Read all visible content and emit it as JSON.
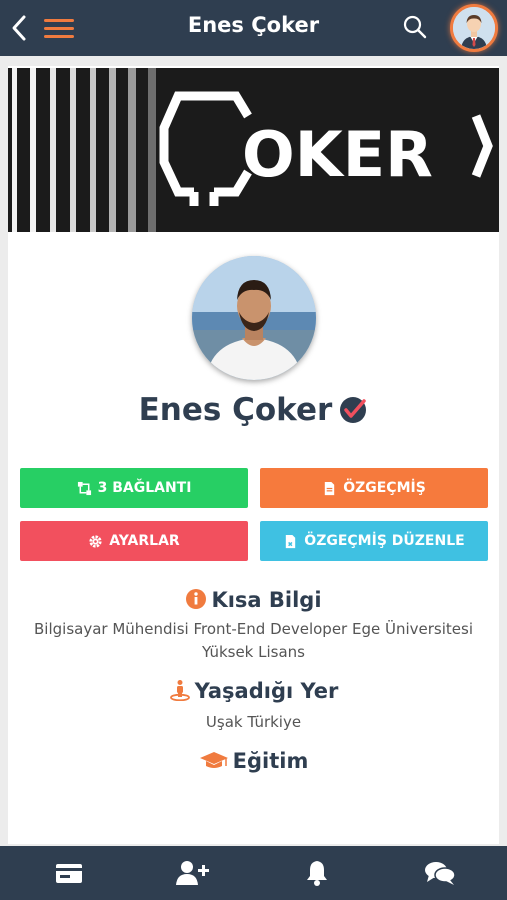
{
  "header": {
    "title": "Enes Çoker",
    "accent_color": "#f07b3f",
    "background_color": "#2f3e50"
  },
  "cover": {
    "logo_text": "ÇOKER"
  },
  "profile": {
    "name": "Enes Çoker",
    "verified": true
  },
  "buttons": {
    "connections": "3 BAĞLANTI",
    "resume": "ÖZGEÇMİŞ",
    "settings": "AYARLAR",
    "edit_resume": "ÖZGEÇMİŞ DÜZENLE"
  },
  "sections": {
    "about": {
      "title": "Kısa Bilgi",
      "text": "Bilgisayar Mühendisi Front-End Developer Ege Üniversitesi Yüksek Lisans"
    },
    "location": {
      "title": "Yaşadığı Yer",
      "text": "Uşak Türkiye"
    },
    "education": {
      "title": "Eğitim"
    }
  },
  "bottom_nav": [
    "card-icon",
    "add-user-icon",
    "bell-icon",
    "chat-icon"
  ]
}
